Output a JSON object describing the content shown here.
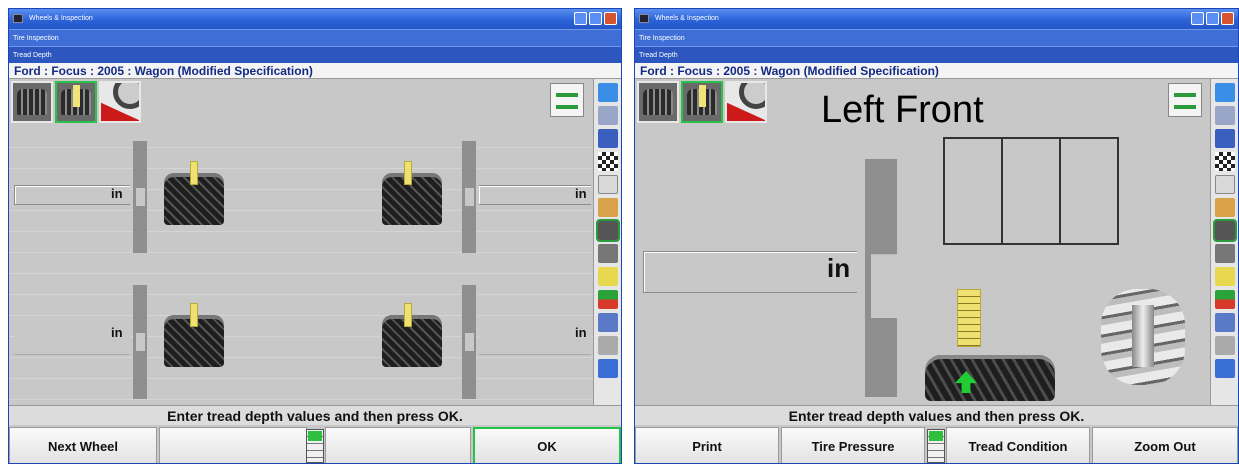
{
  "colors": {
    "titlebar": "#2c63d8",
    "accent": "#25c24a",
    "vehicle_text": "#132a85"
  },
  "left": {
    "titlebar": "Wheels & Inspection",
    "subtitle": "Tire Inspection",
    "subtitle2": "Tread Depth",
    "vehicle": "Ford : Focus : 2005 : Wagon (Modified Specification)",
    "unit": "in",
    "instruction": "Enter tread depth values and then press OK.",
    "buttons": {
      "b1": "Next Wheel",
      "b2": "",
      "b3": "",
      "b4": "OK"
    },
    "active_button": "OK"
  },
  "right": {
    "titlebar": "Wheels & Inspection",
    "subtitle": "Tire Inspection",
    "subtitle2": "Tread Depth",
    "vehicle": "Ford : Focus : 2005 : Wagon (Modified Specification)",
    "heading": "Left Front",
    "unit": "in",
    "instruction": "Enter tread depth values and then press OK.",
    "buttons": {
      "b1": "Print",
      "b2": "Tire Pressure",
      "b3": "Tread Condition",
      "b4": "Zoom Out"
    }
  },
  "sidebar_icons": [
    "help-icon",
    "wrench-icon",
    "lift-icon",
    "checkered-flag-icon",
    "spec-icon",
    "tool-icon",
    "tire-icon",
    "tire-side-icon",
    "tread-gauge-icon",
    "pressure-icon",
    "tpms-icon",
    "battery-icon",
    "car-icon"
  ]
}
